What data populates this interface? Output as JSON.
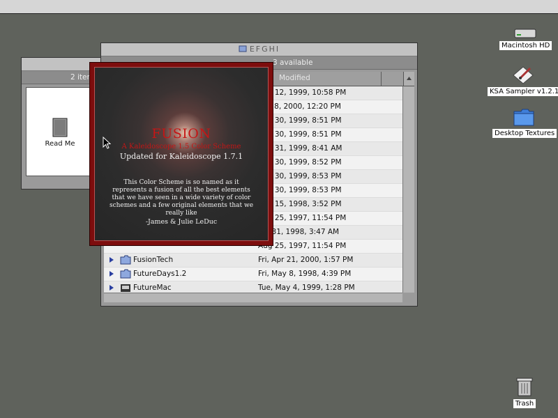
{
  "desktop": {
    "icons": [
      {
        "label": "Macintosh HD",
        "icon": "hard-drive-icon"
      },
      {
        "label": "KSA Sampler v1.2.1",
        "icon": "application-icon"
      },
      {
        "label": "Desktop Textures",
        "icon": "folder-icon"
      },
      {
        "label": "Trash",
        "icon": "trash-icon"
      }
    ]
  },
  "back_window": {
    "items_count": "2 item",
    "item_label": "Read Me"
  },
  "main_window": {
    "title": "EFGHI",
    "available": "3 available",
    "column_modified": "Modified",
    "rows": [
      {
        "name": "",
        "date": "Nov 12, 1999, 10:58 PM"
      },
      {
        "name": "",
        "date": "Mar 8, 2000, 12:20 PM"
      },
      {
        "name": "",
        "date": "Aug 30, 1999, 8:51 PM"
      },
      {
        "name": "",
        "date": "Aug 30, 1999, 8:51 PM"
      },
      {
        "name": "",
        "date": "Aug 31, 1999, 8:41 AM"
      },
      {
        "name": "",
        "date": "Aug 30, 1999, 8:52 PM"
      },
      {
        "name": "",
        "date": "Aug 30, 1999, 8:53 PM"
      },
      {
        "name": "",
        "date": "Aug 30, 1999, 8:53 PM"
      },
      {
        "name": "",
        "date": "Nov 15, 1998, 3:52 PM"
      },
      {
        "name": "",
        "date": "Aug 25, 1997, 11:54 PM"
      },
      {
        "name": "",
        "date": "Jan 31, 1998, 3:47 AM"
      },
      {
        "name": "",
        "date": "Aug 25, 1997, 11:54 PM"
      },
      {
        "name": "FusionTech",
        "date": "Fri, Apr 21, 2000, 1:57 PM"
      },
      {
        "name": "FutureDays1.2",
        "date": "Fri, May 8, 1998, 4:39 PM"
      },
      {
        "name": "FutureMac",
        "date": "Tue, May 4, 1999, 1:28 PM"
      }
    ]
  },
  "splash": {
    "title": "FUSION",
    "subtitle": "A Kaleidoscope 1.5 Color Scheme",
    "updated": "Updated for Kaleidoscope 1.7.1",
    "body": "This Color Scheme is so named as it represents a fusion  of all the best elements that we have seen in a wide variety of color schemes and a few original elements  that we really like",
    "signature": "-James & Julie LeDuc"
  }
}
